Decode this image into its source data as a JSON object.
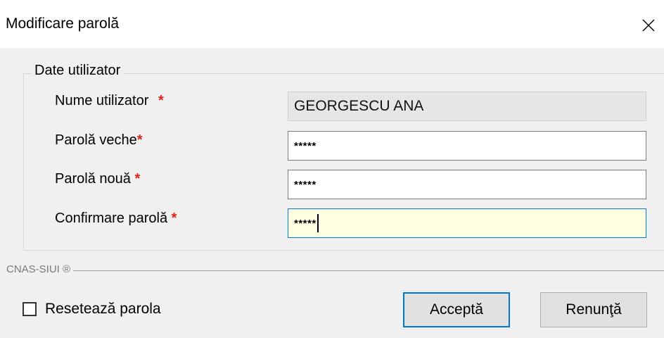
{
  "window": {
    "title": "Modificare parolă",
    "close_icon": "close-icon"
  },
  "group": {
    "legend": "Date utilizator",
    "fields": [
      {
        "label": "Nume utilizator",
        "required_mark": "*",
        "value": "GEORGESCU ANA",
        "readonly": true
      },
      {
        "label": "Parolă veche",
        "required_mark": "*",
        "value": "*****"
      },
      {
        "label": "Parolă nouă",
        "required_mark": "*",
        "value": "*****"
      },
      {
        "label": "Confirmare parolă",
        "required_mark": "*",
        "value": "*****",
        "focused": true
      }
    ]
  },
  "footer": {
    "brand": "CNAS-SIUI ®"
  },
  "reset": {
    "label": "Resetează parola",
    "checked": false
  },
  "buttons": {
    "accept": "Acceptă",
    "cancel": "Renunţă"
  },
  "colors": {
    "required": "#e0241c",
    "focus_border": "#0078d7",
    "focus_background": "#ffffe1",
    "dialog_background": "#f0f0f0"
  }
}
